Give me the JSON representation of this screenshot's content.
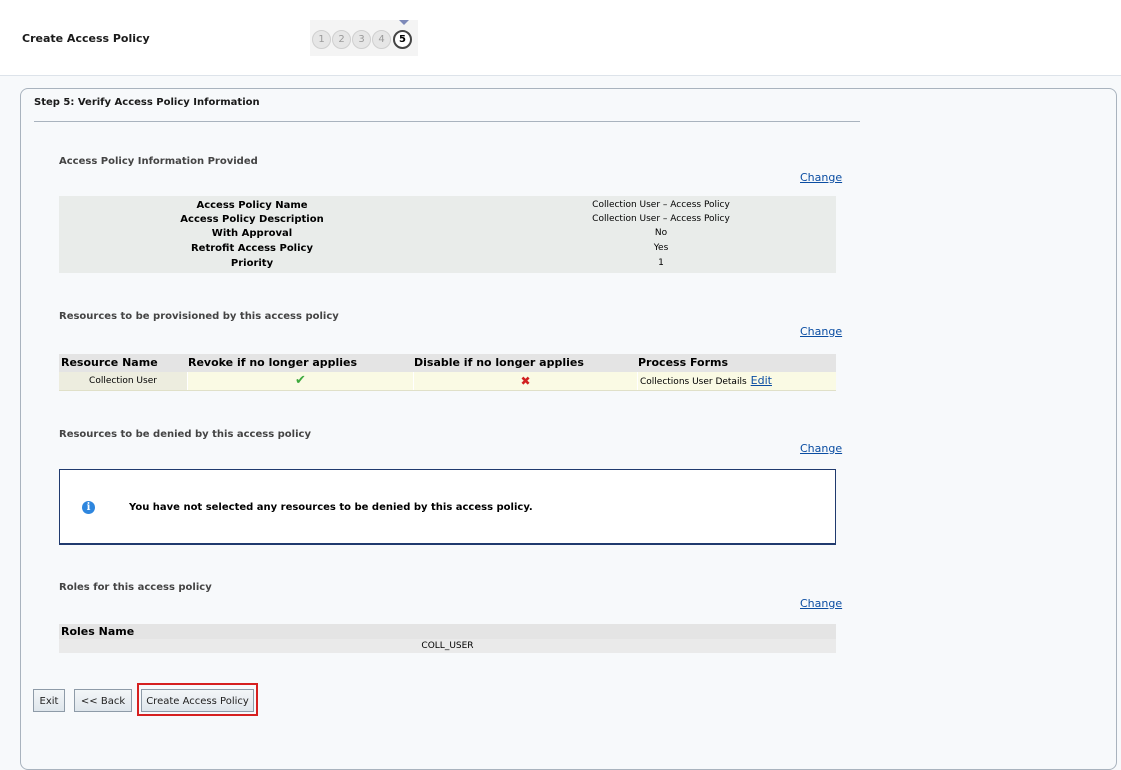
{
  "header": {
    "title": "Create Access Policy"
  },
  "train": {
    "steps": [
      "1",
      "2",
      "3",
      "4",
      "5"
    ],
    "current": 5
  },
  "step_heading": "Step 5: Verify Access Policy Information",
  "change_label": "Change",
  "policy_info": {
    "title": "Access Policy Information Provided",
    "rows": [
      {
        "label": "Access Policy Name",
        "value": "Collection User – Access Policy"
      },
      {
        "label": "Access Policy Description",
        "value": "Collection User – Access Policy"
      },
      {
        "label": "With Approval",
        "value": "No"
      },
      {
        "label": "Retrofit Access Policy",
        "value": "Yes"
      },
      {
        "label": "Priority",
        "value": "1"
      }
    ]
  },
  "resources": {
    "title": "Resources to be provisioned by this access policy",
    "columns": [
      "Resource Name",
      "Revoke if no longer applies",
      "Disable if no longer applies",
      "Process Forms"
    ],
    "rows": [
      {
        "name": "Collection User",
        "revoke": "check-icon",
        "disable": "cross-icon",
        "process_form": "Collections User Details",
        "edit_label": "Edit"
      }
    ]
  },
  "denied": {
    "title": "Resources to be denied by this access policy",
    "message": "You have not selected any resources to be denied by this access policy."
  },
  "roles": {
    "title": "Roles for this access policy",
    "column": "Roles Name",
    "rows": [
      "COLL_USER"
    ]
  },
  "buttons": {
    "exit": "Exit",
    "back": "<< Back",
    "create": "Create Access Policy"
  },
  "colors": {
    "link": "#0a4da2",
    "highlight": "#d62020",
    "check": "#3da93d",
    "cross": "#d12020"
  }
}
